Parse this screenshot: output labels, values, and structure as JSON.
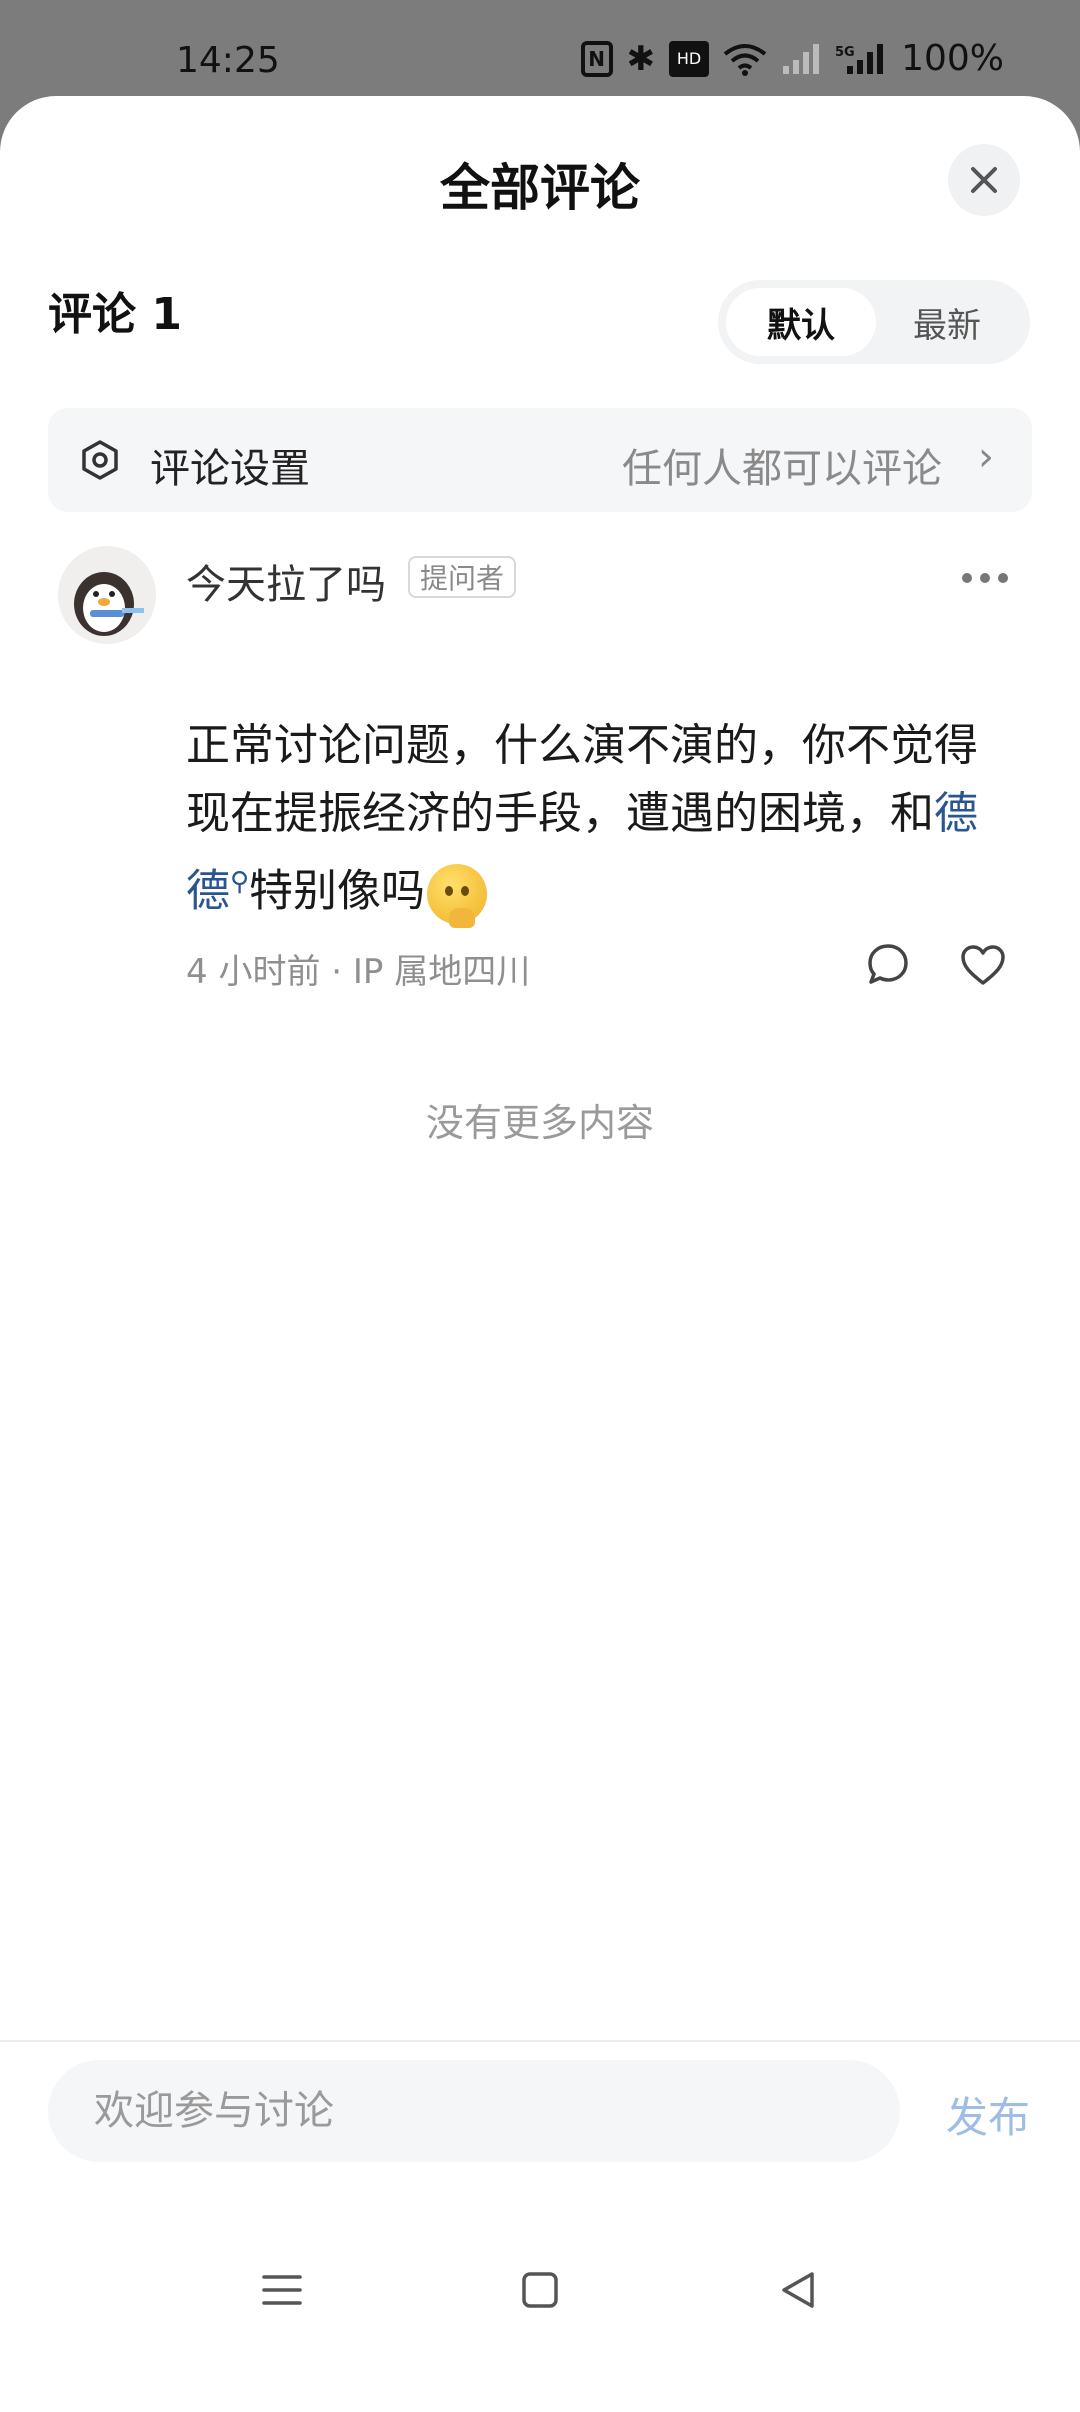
{
  "status_bar": {
    "time": "14:25",
    "network": "5G",
    "battery": "100%"
  },
  "sheet": {
    "title": "全部评论"
  },
  "comments_header": {
    "count_label": "评论 1"
  },
  "sort": {
    "default_label": "默认",
    "latest_label": "最新"
  },
  "settings": {
    "label": "评论设置",
    "value": "任何人都可以评论"
  },
  "comment": {
    "username": "今天拉了吗",
    "badge": "提问者",
    "text_part1": "正常讨论问题，什么演不演的，你不觉得现在提振经济的手段，遭遇的困境，和",
    "link_text": "德德",
    "text_part2": "特别像吗",
    "meta": "4 小时前 · IP 属地四川"
  },
  "list_end": "没有更多内容",
  "composer": {
    "placeholder": "欢迎参与讨论",
    "publish_label": "发布"
  },
  "colors": {
    "accent_link": "#2a5690",
    "publish_disabled": "#9dbde6",
    "background_dim": "#7c7c7c"
  }
}
